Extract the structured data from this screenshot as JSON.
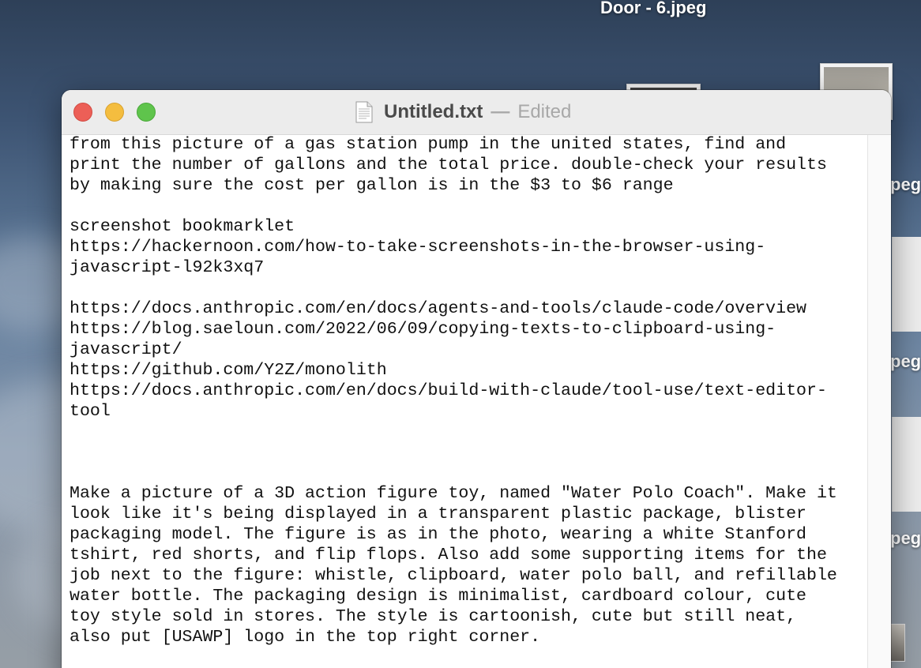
{
  "desktop": {
    "top_file_label": "Door - 6.jpeg",
    "edge_labels": [
      "peg",
      "peg",
      "peg"
    ]
  },
  "window": {
    "title": "Untitled.txt",
    "separator": "—",
    "status": "Edited",
    "doc_icon": "text-document-icon"
  },
  "traffic_lights": {
    "close_color": "#ec5f57",
    "minimize_color": "#f4bd3f",
    "maximize_color": "#5fc44c"
  },
  "editor": {
    "lines": [
      "from this picture of a gas station pump in the united states, find and",
      "print the number of gallons and the total price. double-check your results",
      "by making sure the cost per gallon is in the $3 to $6 range",
      "",
      "screenshot bookmarklet",
      "https://hackernoon.com/how-to-take-screenshots-in-the-browser-using-",
      "javascript-l92k3xq7",
      "",
      "https://docs.anthropic.com/en/docs/agents-and-tools/claude-code/overview",
      "https://blog.saeloun.com/2022/06/09/copying-texts-to-clipboard-using-",
      "javascript/",
      "https://github.com/Y2Z/monolith",
      "https://docs.anthropic.com/en/docs/build-with-claude/tool-use/text-editor-",
      "tool",
      "",
      "",
      "",
      "Make a picture of a 3D action figure toy, named \"Water Polo Coach\". Make it",
      "look like it's being displayed in a transparent plastic package, blister",
      "packaging model. The figure is as in the photo, wearing a white Stanford",
      "tshirt, red shorts, and flip flops. Also add some supporting items for the",
      "job next to the figure: whistle, clipboard, water polo ball, and refillable",
      "water bottle. The packaging design is minimalist, cardboard colour, cute",
      "toy style sold in stores. The style is cartoonish, cute but still neat,",
      "also put [USAWP] logo in the top right corner."
    ]
  }
}
